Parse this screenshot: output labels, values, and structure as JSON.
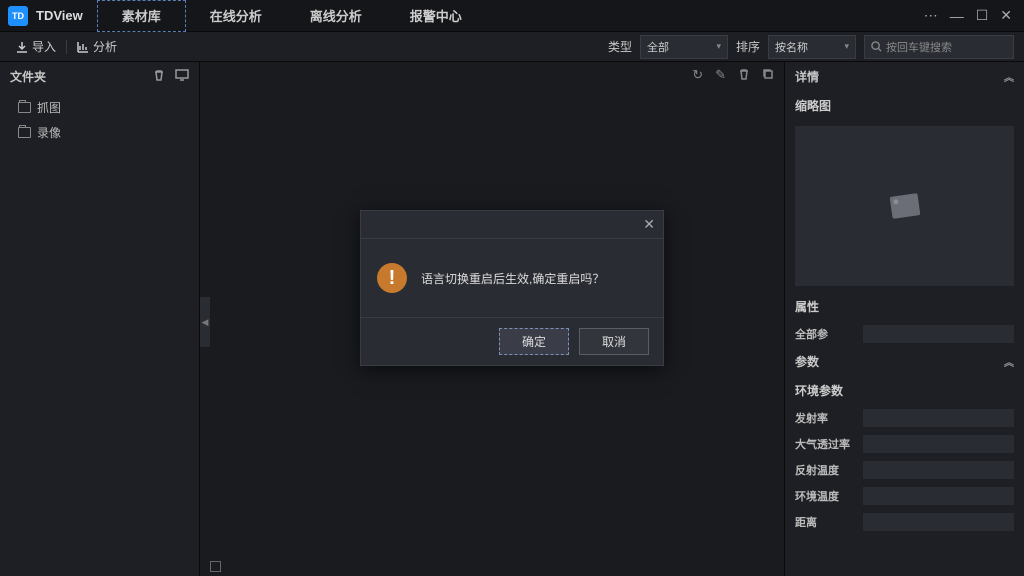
{
  "app": {
    "name": "TDView"
  },
  "nav": {
    "tabs": [
      "素材库",
      "在线分析",
      "离线分析",
      "报警中心"
    ],
    "active": 0
  },
  "toolbar": {
    "import": "导入",
    "analyze": "分析",
    "type_label": "类型",
    "type_value": "全部",
    "sort_label": "排序",
    "sort_value": "按名称",
    "search_placeholder": "按回车键搜索"
  },
  "sidebar": {
    "title": "文件夹",
    "items": [
      "抓图",
      "录像"
    ]
  },
  "right": {
    "detail": "详情",
    "thumbnail": "缩略图",
    "attr": "属性",
    "attr_sub": "全部参",
    "params": "参数",
    "env_params": "环境参数",
    "rows": [
      "发射率",
      "大气透过率",
      "反射温度",
      "环境温度",
      "距离"
    ]
  },
  "dialog": {
    "message": "语言切换重启后生效,确定重启吗？",
    "ok": "确定",
    "cancel": "取消"
  }
}
